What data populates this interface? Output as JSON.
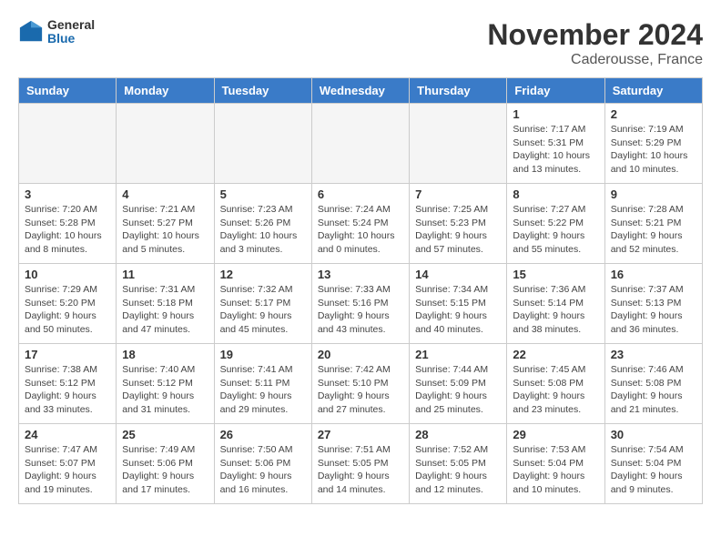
{
  "header": {
    "logo_general": "General",
    "logo_blue": "Blue",
    "month_title": "November 2024",
    "subtitle": "Caderousse, France"
  },
  "columns": [
    "Sunday",
    "Monday",
    "Tuesday",
    "Wednesday",
    "Thursday",
    "Friday",
    "Saturday"
  ],
  "weeks": [
    [
      {
        "day": "",
        "info": ""
      },
      {
        "day": "",
        "info": ""
      },
      {
        "day": "",
        "info": ""
      },
      {
        "day": "",
        "info": ""
      },
      {
        "day": "",
        "info": ""
      },
      {
        "day": "1",
        "info": "Sunrise: 7:17 AM\nSunset: 5:31 PM\nDaylight: 10 hours\nand 13 minutes."
      },
      {
        "day": "2",
        "info": "Sunrise: 7:19 AM\nSunset: 5:29 PM\nDaylight: 10 hours\nand 10 minutes."
      }
    ],
    [
      {
        "day": "3",
        "info": "Sunrise: 7:20 AM\nSunset: 5:28 PM\nDaylight: 10 hours\nand 8 minutes."
      },
      {
        "day": "4",
        "info": "Sunrise: 7:21 AM\nSunset: 5:27 PM\nDaylight: 10 hours\nand 5 minutes."
      },
      {
        "day": "5",
        "info": "Sunrise: 7:23 AM\nSunset: 5:26 PM\nDaylight: 10 hours\nand 3 minutes."
      },
      {
        "day": "6",
        "info": "Sunrise: 7:24 AM\nSunset: 5:24 PM\nDaylight: 10 hours\nand 0 minutes."
      },
      {
        "day": "7",
        "info": "Sunrise: 7:25 AM\nSunset: 5:23 PM\nDaylight: 9 hours\nand 57 minutes."
      },
      {
        "day": "8",
        "info": "Sunrise: 7:27 AM\nSunset: 5:22 PM\nDaylight: 9 hours\nand 55 minutes."
      },
      {
        "day": "9",
        "info": "Sunrise: 7:28 AM\nSunset: 5:21 PM\nDaylight: 9 hours\nand 52 minutes."
      }
    ],
    [
      {
        "day": "10",
        "info": "Sunrise: 7:29 AM\nSunset: 5:20 PM\nDaylight: 9 hours\nand 50 minutes."
      },
      {
        "day": "11",
        "info": "Sunrise: 7:31 AM\nSunset: 5:18 PM\nDaylight: 9 hours\nand 47 minutes."
      },
      {
        "day": "12",
        "info": "Sunrise: 7:32 AM\nSunset: 5:17 PM\nDaylight: 9 hours\nand 45 minutes."
      },
      {
        "day": "13",
        "info": "Sunrise: 7:33 AM\nSunset: 5:16 PM\nDaylight: 9 hours\nand 43 minutes."
      },
      {
        "day": "14",
        "info": "Sunrise: 7:34 AM\nSunset: 5:15 PM\nDaylight: 9 hours\nand 40 minutes."
      },
      {
        "day": "15",
        "info": "Sunrise: 7:36 AM\nSunset: 5:14 PM\nDaylight: 9 hours\nand 38 minutes."
      },
      {
        "day": "16",
        "info": "Sunrise: 7:37 AM\nSunset: 5:13 PM\nDaylight: 9 hours\nand 36 minutes."
      }
    ],
    [
      {
        "day": "17",
        "info": "Sunrise: 7:38 AM\nSunset: 5:12 PM\nDaylight: 9 hours\nand 33 minutes."
      },
      {
        "day": "18",
        "info": "Sunrise: 7:40 AM\nSunset: 5:12 PM\nDaylight: 9 hours\nand 31 minutes."
      },
      {
        "day": "19",
        "info": "Sunrise: 7:41 AM\nSunset: 5:11 PM\nDaylight: 9 hours\nand 29 minutes."
      },
      {
        "day": "20",
        "info": "Sunrise: 7:42 AM\nSunset: 5:10 PM\nDaylight: 9 hours\nand 27 minutes."
      },
      {
        "day": "21",
        "info": "Sunrise: 7:44 AM\nSunset: 5:09 PM\nDaylight: 9 hours\nand 25 minutes."
      },
      {
        "day": "22",
        "info": "Sunrise: 7:45 AM\nSunset: 5:08 PM\nDaylight: 9 hours\nand 23 minutes."
      },
      {
        "day": "23",
        "info": "Sunrise: 7:46 AM\nSunset: 5:08 PM\nDaylight: 9 hours\nand 21 minutes."
      }
    ],
    [
      {
        "day": "24",
        "info": "Sunrise: 7:47 AM\nSunset: 5:07 PM\nDaylight: 9 hours\nand 19 minutes."
      },
      {
        "day": "25",
        "info": "Sunrise: 7:49 AM\nSunset: 5:06 PM\nDaylight: 9 hours\nand 17 minutes."
      },
      {
        "day": "26",
        "info": "Sunrise: 7:50 AM\nSunset: 5:06 PM\nDaylight: 9 hours\nand 16 minutes."
      },
      {
        "day": "27",
        "info": "Sunrise: 7:51 AM\nSunset: 5:05 PM\nDaylight: 9 hours\nand 14 minutes."
      },
      {
        "day": "28",
        "info": "Sunrise: 7:52 AM\nSunset: 5:05 PM\nDaylight: 9 hours\nand 12 minutes."
      },
      {
        "day": "29",
        "info": "Sunrise: 7:53 AM\nSunset: 5:04 PM\nDaylight: 9 hours\nand 10 minutes."
      },
      {
        "day": "30",
        "info": "Sunrise: 7:54 AM\nSunset: 5:04 PM\nDaylight: 9 hours\nand 9 minutes."
      }
    ]
  ]
}
